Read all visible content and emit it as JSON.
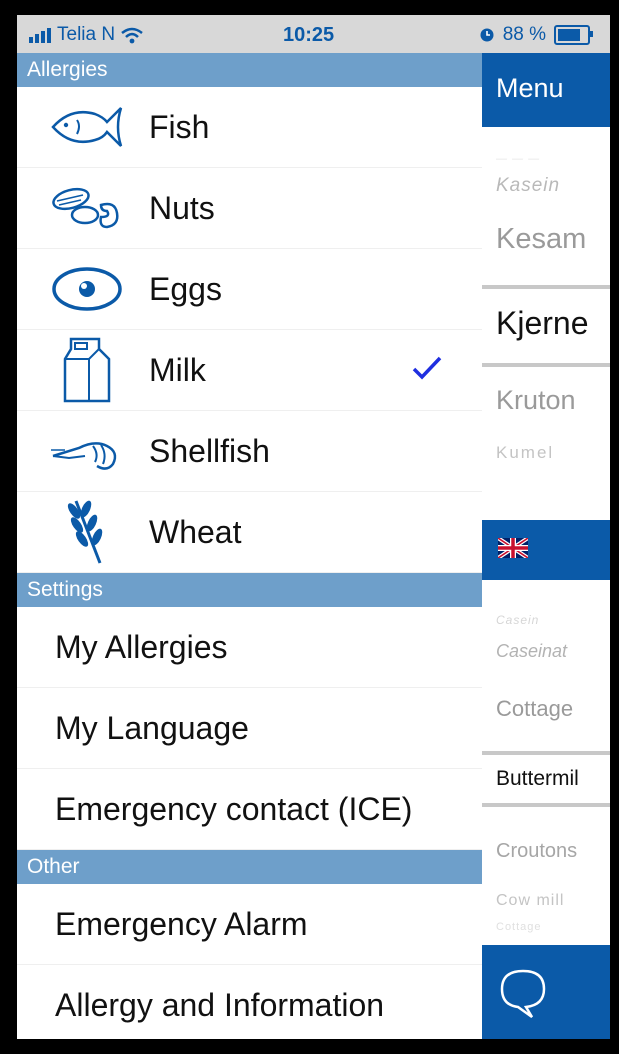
{
  "status": {
    "carrier": "Telia N",
    "time": "10:25",
    "battery": "88 %"
  },
  "drawer": {
    "allergies_header": "Allergies",
    "allergies": [
      {
        "label": "Fish",
        "icon": "fish-icon",
        "checked": false
      },
      {
        "label": "Nuts",
        "icon": "nuts-icon",
        "checked": false
      },
      {
        "label": "Eggs",
        "icon": "egg-icon",
        "checked": false
      },
      {
        "label": "Milk",
        "icon": "milk-carton-icon",
        "checked": true
      },
      {
        "label": "Shellfish",
        "icon": "shrimp-icon",
        "checked": false
      },
      {
        "label": "Wheat",
        "icon": "wheat-icon",
        "checked": false
      }
    ],
    "settings_header": "Settings",
    "settings": [
      "My Allergies",
      "My Language",
      "Emergency contact (ICE)"
    ],
    "other_header": "Other",
    "other": [
      "Emergency Alarm",
      "Allergy and Information"
    ]
  },
  "right_panel": {
    "menu_label": "Menu",
    "norwegian_words": [
      "Kasein",
      "Kesam",
      "Kjerne",
      "Kruton",
      "Kumel"
    ],
    "english_words": [
      "Casein",
      "Caseinat",
      "Cottage",
      "Buttermil",
      "Croutons",
      "Cow mill",
      "Cottage"
    ]
  },
  "colors": {
    "accent": "#0b5aa8",
    "section_header": "#6e9fca",
    "check": "#1f2fe0"
  }
}
